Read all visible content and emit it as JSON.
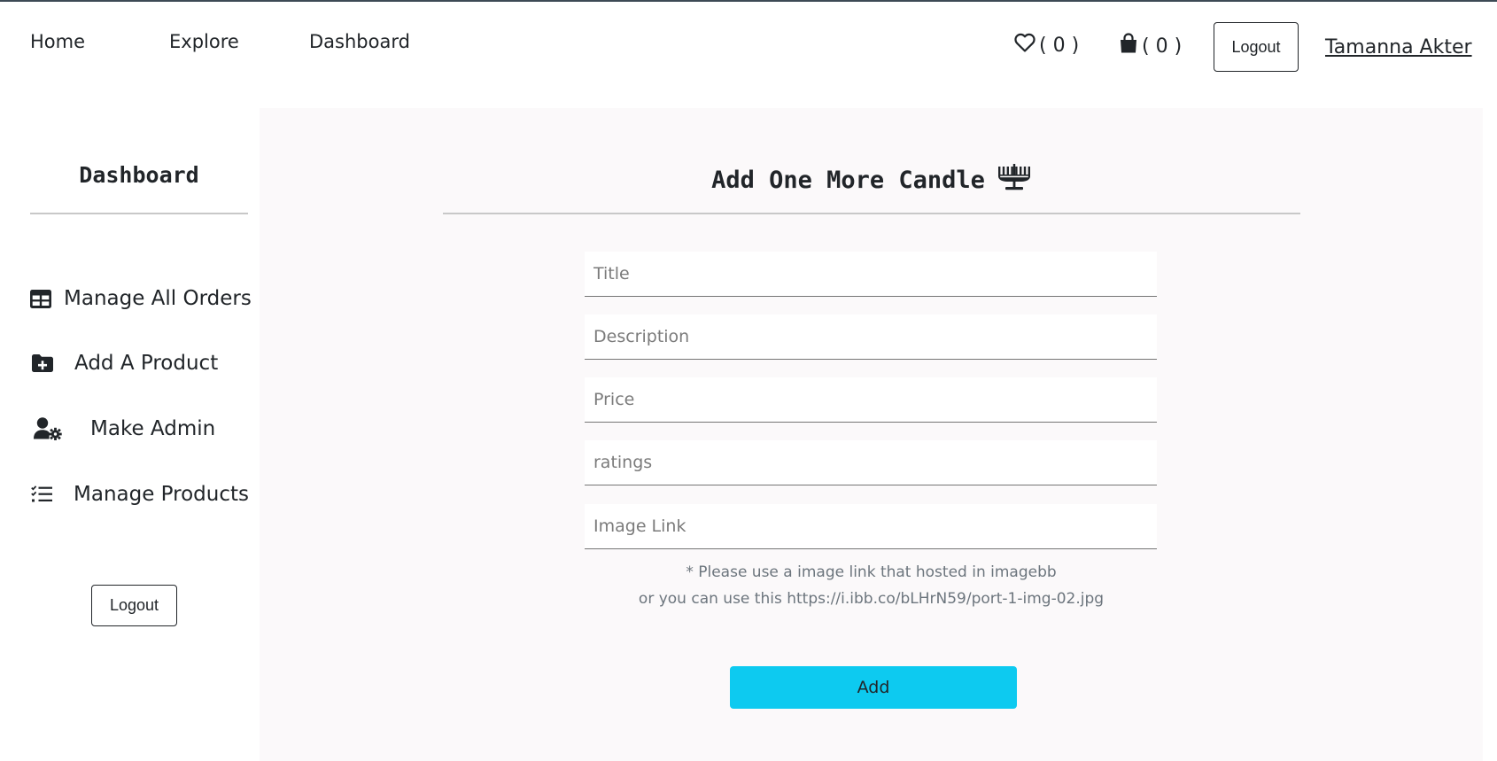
{
  "nav": {
    "home": "Home",
    "explore": "Explore",
    "dashboard": "Dashboard",
    "wishlist_count": "( 0 )",
    "cart_count": "( 0 )",
    "logout": "Logout",
    "user_name": "Tamanna Akter"
  },
  "sidebar": {
    "title": "Dashboard",
    "items": [
      {
        "label": "Manage All Orders",
        "icon": "table-icon"
      },
      {
        "label": "Add A Product",
        "icon": "folder-plus-icon"
      },
      {
        "label": "Make Admin",
        "icon": "user-cog-icon"
      },
      {
        "label": "Manage Products",
        "icon": "checklist-icon"
      }
    ],
    "logout": "Logout"
  },
  "main": {
    "title": "Add One More Candle",
    "title_icon": "menorah-icon",
    "fields": {
      "title_placeholder": "Title",
      "description_placeholder": "Description",
      "price_placeholder": "Price",
      "ratings_placeholder": "ratings",
      "image_placeholder": "Image Link"
    },
    "note_line1": "* Please use a image link that hosted in imagebb",
    "note_line2": "or you can use this https://i.ibb.co/bLHrN59/port-1-img-02.jpg",
    "add_button": "Add"
  },
  "colors": {
    "accent": "#0dcaf0",
    "panel_background": "#fbf9fa",
    "text": "#212529",
    "muted_text": "#6c757d"
  }
}
